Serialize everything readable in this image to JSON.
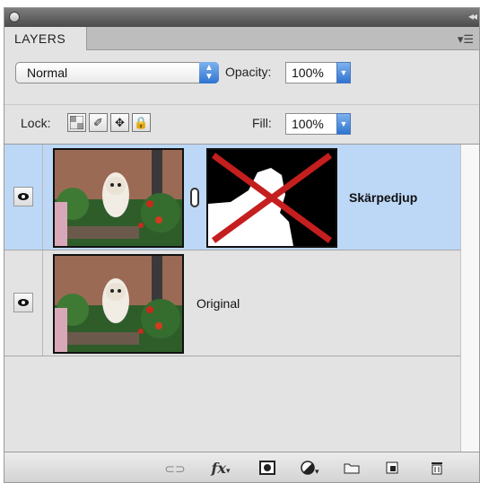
{
  "panel": {
    "tab_label": "LAYERS",
    "collapse_icon": "double-chevron-right-icon",
    "menu_icon": "panel-menu-icon"
  },
  "options": {
    "blend_mode": "Normal",
    "opacity_label": "Opacity:",
    "opacity_value": "100%",
    "lock_label": "Lock:",
    "fill_label": "Fill:",
    "fill_value": "100%"
  },
  "lock_buttons": [
    "lock-transparency-icon",
    "lock-image-icon",
    "lock-position-icon",
    "lock-all-icon"
  ],
  "layers": [
    {
      "name": "Skärpedjup",
      "selected": true,
      "has_mask": true,
      "visible": true
    },
    {
      "name": "Original",
      "selected": false,
      "has_mask": false,
      "visible": true
    }
  ],
  "bottom_icons": [
    "link-layers-icon",
    "fx-icon",
    "add-mask-icon",
    "adjustment-layer-icon",
    "new-group-icon",
    "new-layer-icon",
    "trash-icon"
  ],
  "colors": {
    "selection": "#bdd8f7",
    "panel_bg": "#e3e3e3",
    "mask_cross": "#c41e1e"
  }
}
